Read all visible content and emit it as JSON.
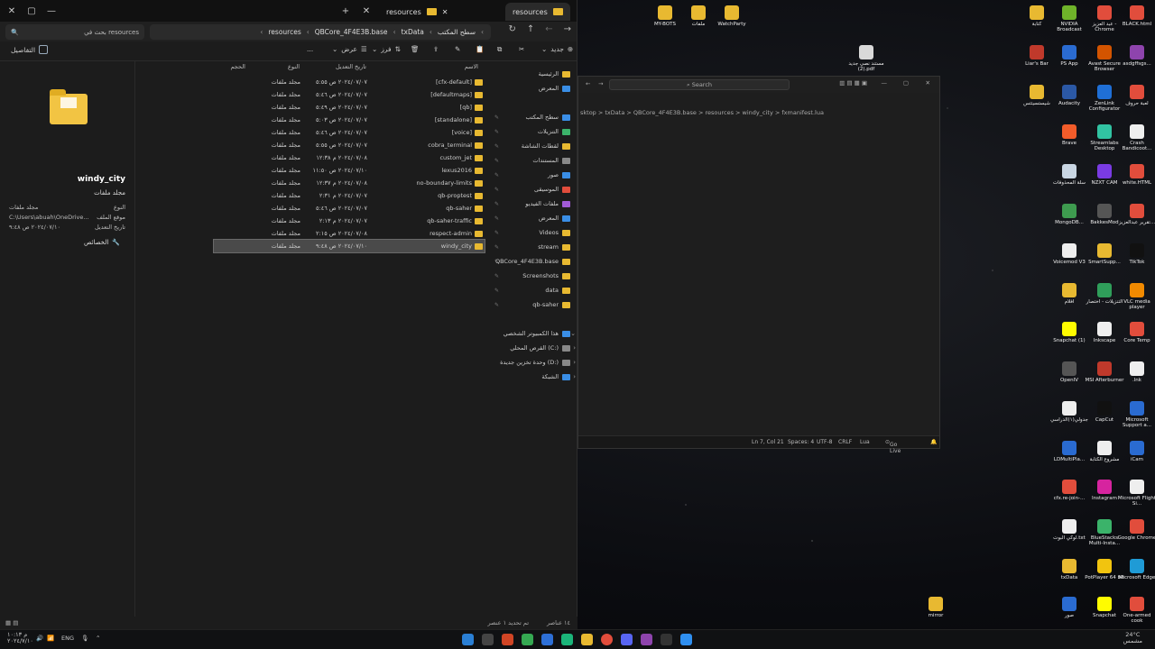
{
  "explorer": {
    "tabs": [
      {
        "label": "resources"
      },
      {
        "label": "resources"
      }
    ],
    "add_tab": "+",
    "search_placeholder": "بحث في resources",
    "breadcrumbs": [
      "resources",
      "QBCore_4F4E3B.base",
      "txData",
      "سطح المكتب"
    ],
    "commands": {
      "new": "جديد",
      "sort": "فرز",
      "view": "عرض",
      "more": "...",
      "details": "التفاصيل"
    },
    "details_pane": {
      "name": "windy_city",
      "type_title": "مجلد ملفات",
      "rows": [
        {
          "label": "النوع",
          "value": "مجلد ملفات"
        },
        {
          "label": "موقع الملف",
          "value": "C:\\Users\\abuah\\OneDrive..."
        },
        {
          "label": "تاريخ التعديل",
          "value": "٢٠٢٤/٠٧/١٠ ص ٩:٤٨"
        }
      ],
      "properties": "الخصائص"
    },
    "columns": {
      "name": "الاسم",
      "modified": "تاريخ التعديل",
      "type": "النوع",
      "size": "الحجم"
    },
    "files": [
      {
        "name": "[cfx-default]",
        "date": "٢٠٢٤/٠٧/٠٧ ص ٥:٥٥",
        "type": "مجلد ملفات"
      },
      {
        "name": "[defaultmaps]",
        "date": "٢٠٢٤/٠٧/٠٧ ص ٥:٤٦",
        "type": "مجلد ملفات"
      },
      {
        "name": "[qb]",
        "date": "٢٠٢٤/٠٧/٠٧ ص ٥:٤٩",
        "type": "مجلد ملفات"
      },
      {
        "name": "[standalone]",
        "date": "٢٠٢٤/٠٧/٠٧ ص ٥:٠٣",
        "type": "مجلد ملفات"
      },
      {
        "name": "[voice]",
        "date": "٢٠٢٤/٠٧/٠٧ ص ٥:٤٦",
        "type": "مجلد ملفات"
      },
      {
        "name": "cobra_terminal",
        "date": "٢٠٢٤/٠٧/٠٧ ص ٥:٥٥",
        "type": "مجلد ملفات"
      },
      {
        "name": "custom_jet",
        "date": "٢٠٢٤/٠٧/٠٨ م ١٢:٣٨",
        "type": "مجلد ملفات"
      },
      {
        "name": "lexus2016",
        "date": "٢٠٢٤/٠٧/١٠ ص ١١:٥٠",
        "type": "مجلد ملفات"
      },
      {
        "name": "no-boundary-limits",
        "date": "٢٠٢٤/٠٧/٠٨ م ١٢:٣٧",
        "type": "مجلد ملفات"
      },
      {
        "name": "qb-proptest",
        "date": "٢٠٢٤/٠٧/٠٧ م ٢:٣١",
        "type": "مجلد ملفات"
      },
      {
        "name": "qb-saher",
        "date": "٢٠٢٤/٠٧/٠٧ ص ٥:٤٦",
        "type": "مجلد ملفات"
      },
      {
        "name": "qb-saher-traffic",
        "date": "٢٠٢٤/٠٧/٠٧ م ٢:١٣",
        "type": "مجلد ملفات"
      },
      {
        "name": "respect-admin",
        "date": "٢٠٢٤/٠٧/٠٨ ص ٢:١٥",
        "type": "مجلد ملفات"
      },
      {
        "name": "windy_city",
        "date": "٢٠٢٤/٠٧/١٠ ص ٩:٤٨",
        "type": "مجلد ملفات",
        "selected": true
      }
    ],
    "nav": [
      {
        "label": "الرئيسية",
        "icon": "home-icon"
      },
      {
        "label": "المعرض",
        "icon": "gallery-icon"
      },
      {
        "label": "سطح المكتب",
        "icon": "desktop-icon"
      },
      {
        "label": "التنزيلات",
        "icon": "downloads-icon"
      },
      {
        "label": "لقطات الشاشة",
        "icon": "folder-icon"
      },
      {
        "label": "المستندات",
        "icon": "documents-icon"
      },
      {
        "label": "صور",
        "icon": "pictures-icon"
      },
      {
        "label": "الموسيقى",
        "icon": "music-icon"
      },
      {
        "label": "ملفات الفيديو",
        "icon": "videos-icon"
      },
      {
        "label": "المعرض",
        "icon": "gallery-icon"
      },
      {
        "label": "Videos",
        "icon": "folder-icon"
      },
      {
        "label": "stream",
        "icon": "folder-icon"
      },
      {
        "label": "QBCore_4F4E3B.base",
        "icon": "folder-icon"
      },
      {
        "label": "Screenshots",
        "icon": "folder-icon"
      },
      {
        "label": "data",
        "icon": "folder-icon"
      },
      {
        "label": "qb-saher",
        "icon": "folder-icon"
      },
      {
        "label": "هذا الكمبيوتر الشخصي",
        "icon": "pc-icon"
      },
      {
        "label": "القرص المحلي (C:)",
        "icon": "drive-icon"
      },
      {
        "label": "وحدة تخزين جديدة (D:)",
        "icon": "drive-icon"
      },
      {
        "label": "الشبكة",
        "icon": "network-icon"
      }
    ],
    "status": {
      "count": "١٤ عناصر",
      "selected": "تم تحديد ١ عنصر"
    }
  },
  "vscode": {
    "search": "Search",
    "breadcrumb": "sktop > txData > QBCore_4F4E3B.base > resources > windy_city > fxmanifest.lua",
    "status": {
      "position": "Ln 7, Col 21",
      "spaces": "Spaces: 4",
      "encoding": "UTF-8",
      "eol": "CRLF",
      "language": "Lua",
      "golive": "Go Live"
    }
  },
  "desktop_icons": [
    {
      "label": "MY-BOTS",
      "color": "#e8b931"
    },
    {
      "label": "ملفات",
      "color": "#e8b931"
    },
    {
      "label": "WatchParty",
      "color": "#e8b931"
    },
    {
      "label": "مستند نصي جديد (2).pdf",
      "color": "#d9d9d9"
    },
    {
      "label": "كتابة",
      "color": "#e8b931"
    },
    {
      "label": "NVIDIA Broadcast",
      "color": "#6fb32a"
    },
    {
      "label": "عبد العزيز - Chrome",
      "color": "#e14d3c"
    },
    {
      "label": "BLACK.html",
      "color": "#e14d3c"
    },
    {
      "label": "Liar's Bar",
      "color": "#c0392b"
    },
    {
      "label": "PS App",
      "color": "#2a6bd1"
    },
    {
      "label": "Avast Secure Browser",
      "color": "#d35400"
    },
    {
      "label": "asdgffsgs...",
      "color": "#8e44ad"
    },
    {
      "label": "شيستسيتتس",
      "color": "#e8b931"
    },
    {
      "label": "Audacity",
      "color": "#2b58a5"
    },
    {
      "label": "ZenLink Configurator",
      "color": "#1f6fd6"
    },
    {
      "label": "لعبة حروف",
      "color": "#e14d3c"
    },
    {
      "label": "Brave",
      "color": "#f25c2a"
    },
    {
      "label": "Streamlabs Desktop",
      "color": "#31c3a2"
    },
    {
      "label": "Crash Bandicoot...",
      "color": "#eeeeee"
    },
    {
      "label": "سلة المحذوفات",
      "color": "#c9d6e3"
    },
    {
      "label": "NZXT CAM",
      "color": "#7a3be3"
    },
    {
      "label": "white.HTML",
      "color": "#e14d3c"
    },
    {
      "label": "MongoDB...",
      "color": "#3e9b4f"
    },
    {
      "label": "BakkesMod",
      "color": "#555555"
    },
    {
      "label": "تقرير عبدالعزيز...",
      "color": "#e14d3c"
    },
    {
      "label": "Voicemod V3",
      "color": "#eeeeee"
    },
    {
      "label": "SmartSupp...",
      "color": "#e8b931"
    },
    {
      "label": "TikTok",
      "color": "#111111"
    },
    {
      "label": "افلام",
      "color": "#e8b931"
    },
    {
      "label": "التنزيلات - اختصار",
      "color": "#2f9e5a"
    },
    {
      "label": "VLC media player",
      "color": "#f18a00"
    },
    {
      "label": "Snapchat (1)",
      "color": "#fffc00"
    },
    {
      "label": "Inkscape",
      "color": "#eeeeee"
    },
    {
      "label": "Core Temp",
      "color": "#e14d3c"
    },
    {
      "label": "OpenIV",
      "color": "#555555"
    },
    {
      "label": "MSI Afterburner",
      "color": "#c0392b"
    },
    {
      "label": ".lnk",
      "color": "#eeeeee"
    },
    {
      "label": "جدولي(١)الدراسي",
      "color": "#eeeeee"
    },
    {
      "label": "CapCut",
      "color": "#111111"
    },
    {
      "label": "Microsoft Support a...",
      "color": "#2a6bd1"
    },
    {
      "label": "LDMultiPla...",
      "color": "#2a6bd1"
    },
    {
      "label": "مشروع الكتابة",
      "color": "#eeeeee"
    },
    {
      "label": "iCam",
      "color": "#2a6bd1"
    },
    {
      "label": "cfx.re-join-...",
      "color": "#e14d3c"
    },
    {
      "label": "Instagram",
      "color": "#d6249f"
    },
    {
      "label": "Microsoft Flight Si...",
      "color": "#eeeeee"
    },
    {
      "label": "لوكي البوت.txt",
      "color": "#eeeeee"
    },
    {
      "label": "BlueStacks Multi-Insta...",
      "color": "#3bb36a"
    },
    {
      "label": "Google Chrome",
      "color": "#e14d3c"
    },
    {
      "label": "txData",
      "color": "#e8b931"
    },
    {
      "label": "PotPlayer 64 bit",
      "color": "#f1c40f"
    },
    {
      "label": "Microsoft Edge",
      "color": "#1f9bd6"
    },
    {
      "label": "mirror",
      "color": "#e8b931"
    },
    {
      "label": "صور",
      "color": "#2a6bd1"
    },
    {
      "label": "Snapchat",
      "color": "#fffc00"
    },
    {
      "label": "One-armed cook",
      "color": "#e14d3c"
    }
  ],
  "taskbar": {
    "weather": "24°C",
    "weather_desc": "مشمس",
    "lang": "ENG",
    "time": "م ١٠:١٣",
    "date": "٢٠٢٤/٧/١٠"
  }
}
